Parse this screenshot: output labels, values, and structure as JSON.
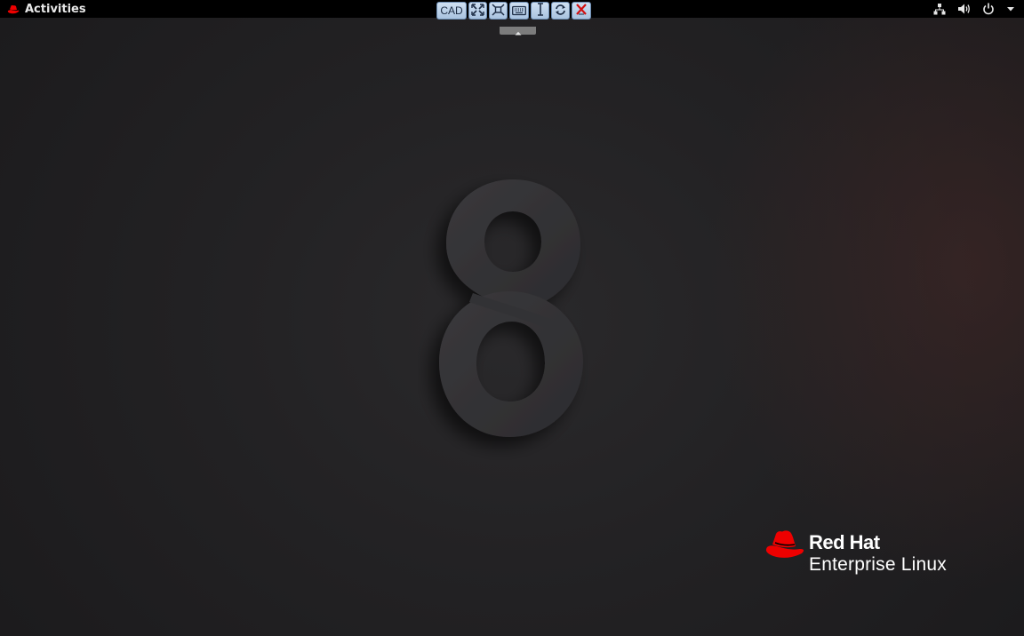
{
  "topbar": {
    "activities_label": "Activities",
    "tray_icons": [
      "network-icon",
      "volume-icon",
      "power-icon",
      "menu-arrow-icon"
    ]
  },
  "vnc_toolbar": {
    "cad_label": "CAD",
    "buttons": [
      "fullscreen-icon",
      "scale-icon",
      "keyboard-icon",
      "text-cursor-icon",
      "refresh-icon",
      "disconnect-icon"
    ]
  },
  "wallpaper": {
    "emblem_text": "8"
  },
  "logo": {
    "brand": "Red Hat",
    "product": "Enterprise Linux",
    "color": "#ee0000"
  },
  "colors": {
    "topbar": "#000000",
    "background": "#232224",
    "toolbar_button": "#bcd3ea"
  }
}
